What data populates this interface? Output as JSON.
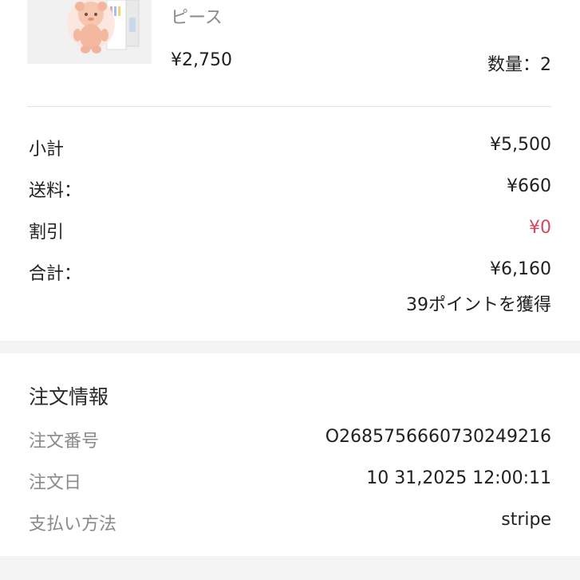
{
  "product": {
    "subtitle": "ピース",
    "price": "¥2,750",
    "quantity": "数量：2"
  },
  "summary": {
    "subtotal_label": "小計",
    "subtotal_value": "¥5,500",
    "shipping_label": "送料：",
    "shipping_value": "¥660",
    "discount_label": "割引",
    "discount_value": "¥0",
    "total_label": "合計：",
    "total_value": "¥6,160",
    "points": "39ポイントを獲得"
  },
  "order_info": {
    "title": "注文情報",
    "number_label": "注文番号",
    "number_value": "O268575666073024921​6",
    "date_label": "注文日",
    "date_value": "10 31,2025 12:00:11",
    "payment_label": "支払い方法",
    "payment_value": "stripe"
  },
  "colors": {
    "discount": "#d6485a",
    "muted_text": "#8a8a8a",
    "section_gap": "#f3f3f3"
  }
}
